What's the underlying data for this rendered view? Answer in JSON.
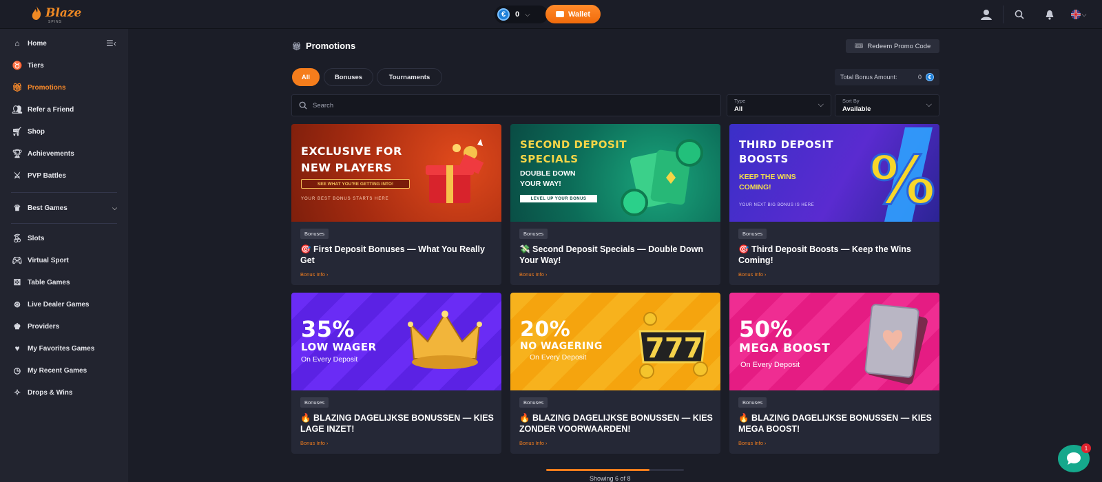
{
  "header": {
    "logo_text": "Blaze",
    "logo_sub": "SPINS",
    "balance": "0",
    "wallet_label": "Wallet",
    "currency_symbol": "€"
  },
  "sidebar": {
    "items": [
      {
        "label": "Home",
        "icon": "home-icon"
      },
      {
        "label": "Tiers",
        "icon": "tiers-icon"
      },
      {
        "label": "Promotions",
        "icon": "gift-icon",
        "active": true
      },
      {
        "label": "Refer a Friend",
        "icon": "users-icon"
      },
      {
        "label": "Shop",
        "icon": "cart-icon"
      },
      {
        "label": "Achievements",
        "icon": "trophy-icon"
      },
      {
        "label": "PVP Battles",
        "icon": "swords-icon"
      }
    ],
    "best_games": "Best Games",
    "games": [
      {
        "label": "Slots",
        "icon": "cherries-icon"
      },
      {
        "label": "Virtual Sport",
        "icon": "gamepad-icon"
      },
      {
        "label": "Table Games",
        "icon": "dice-icon"
      },
      {
        "label": "Live Dealer Games",
        "icon": "chip-icon"
      },
      {
        "label": "Providers",
        "icon": "crown-icon"
      },
      {
        "label": "My Favorites Games",
        "icon": "heart-icon"
      },
      {
        "label": "My Recent Games",
        "icon": "clock-icon"
      },
      {
        "label": "Drops & Wins",
        "icon": "drops-icon"
      }
    ]
  },
  "main": {
    "title": "Promotions",
    "redeem_label": "Redeem Promo Code",
    "tabs": [
      {
        "label": "All",
        "active": true
      },
      {
        "label": "Bonuses"
      },
      {
        "label": "Tournaments"
      }
    ],
    "total_bonus_label": "Total Bonus Amount:",
    "total_bonus_value": "0",
    "search_placeholder": "Search",
    "type_label": "Type",
    "type_value": "All",
    "sort_label": "Sort By",
    "sort_value": "Available",
    "showing": "Showing 6 of 8"
  },
  "cards": [
    {
      "banner_lines": [
        "EXCLUSIVE FOR",
        "NEW PLAYERS"
      ],
      "banner_cta": "SEE WHAT YOU'RE GETTING INTO!",
      "banner_foot": "YOUR BEST BONUS STARTS HERE",
      "tag": "Bonuses",
      "title": "🎯 First Deposit Bonuses — What You Really Get",
      "info": "Bonus Info ›"
    },
    {
      "banner_lines": [
        "SECOND DEPOSIT",
        "SPECIALS"
      ],
      "banner_sub": [
        "DOUBLE DOWN",
        "YOUR WAY!"
      ],
      "banner_foot": "LEVEL UP YOUR BONUS",
      "tag": "Bonuses",
      "title": "💸 Second Deposit Specials — Double Down Your Way!",
      "info": "Bonus Info ›"
    },
    {
      "banner_lines": [
        "THIRD DEPOSIT",
        "BOOSTS"
      ],
      "banner_sub": [
        "KEEP THE WINS",
        "COMING!"
      ],
      "banner_foot": "YOUR NEXT BIG BONUS IS HERE",
      "tag": "Bonuses",
      "title": "🎯 Third Deposit Boosts — Keep the Wins Coming!",
      "info": "Bonus Info ›"
    },
    {
      "banner_big": "35%",
      "banner_lines": [
        "LOW WAGER"
      ],
      "banner_sub": [
        "On Every Deposit"
      ],
      "tag": "Bonuses",
      "title": "🔥 BLAZING DAGELIJKSE BONUSSEN — KIES LAGE INZET!",
      "info": "Bonus Info ›"
    },
    {
      "banner_big": "20%",
      "banner_lines": [
        "NO WAGERING"
      ],
      "banner_sub": [
        "On Every Deposit"
      ],
      "tag": "Bonuses",
      "title": "🔥 BLAZING DAGELIJKSE BONUSSEN — KIES ZONDER VOORWAARDEN!",
      "info": "Bonus Info ›"
    },
    {
      "banner_big": "50%",
      "banner_lines": [
        "MEGA BOOST"
      ],
      "banner_sub": [
        "On Every Deposit"
      ],
      "tag": "Bonuses",
      "title": "🔥 BLAZING DAGELIJKSE BONUSSEN — KIES MEGA BOOST!",
      "info": "Bonus Info ›"
    }
  ],
  "chat_badge": "1",
  "colors": {
    "accent": "#f57d1c",
    "bg": "#1b1d27",
    "sidebar": "#22242f",
    "card": "#252836"
  }
}
